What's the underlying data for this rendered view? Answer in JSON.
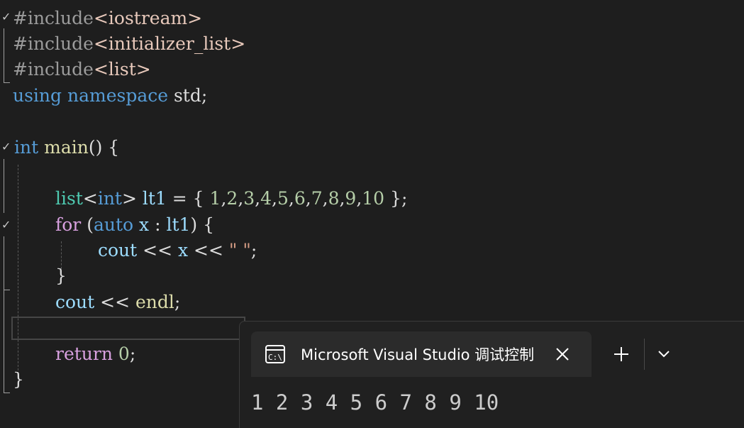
{
  "editor": {
    "lines": [
      {
        "tokens": [
          {
            "t": "#include",
            "c": "pp"
          },
          {
            "t": "<iostream>",
            "c": "inc"
          }
        ]
      },
      {
        "tokens": [
          {
            "t": "#include",
            "c": "pp"
          },
          {
            "t": "<initializer_list>",
            "c": "inc"
          }
        ]
      },
      {
        "tokens": [
          {
            "t": "#include",
            "c": "pp"
          },
          {
            "t": "<list>",
            "c": "inc"
          }
        ]
      },
      {
        "tokens": [
          {
            "t": "using",
            "c": "kw"
          },
          {
            "t": " ",
            "c": "pl"
          },
          {
            "t": "namespace",
            "c": "kw"
          },
          {
            "t": " std;",
            "c": "pl"
          }
        ]
      },
      {
        "tokens": []
      },
      {
        "tokens": [
          {
            "t": "int",
            "c": "kw"
          },
          {
            "t": " ",
            "c": "pl"
          },
          {
            "t": "main",
            "c": "fn"
          },
          {
            "t": "() {",
            "c": "pl"
          }
        ]
      },
      {
        "tokens": []
      },
      {
        "tokens": [
          {
            "t": "list",
            "c": "ty"
          },
          {
            "t": "<",
            "c": "pl"
          },
          {
            "t": "int",
            "c": "kw"
          },
          {
            "t": "> ",
            "c": "pl"
          },
          {
            "t": "lt1",
            "c": "var"
          },
          {
            "t": " = { ",
            "c": "pl"
          },
          {
            "t": "1",
            "c": "num"
          },
          {
            "t": ",",
            "c": "pl"
          },
          {
            "t": "2",
            "c": "num"
          },
          {
            "t": ",",
            "c": "pl"
          },
          {
            "t": "3",
            "c": "num"
          },
          {
            "t": ",",
            "c": "pl"
          },
          {
            "t": "4",
            "c": "num"
          },
          {
            "t": ",",
            "c": "pl"
          },
          {
            "t": "5",
            "c": "num"
          },
          {
            "t": ",",
            "c": "pl"
          },
          {
            "t": "6",
            "c": "num"
          },
          {
            "t": ",",
            "c": "pl"
          },
          {
            "t": "7",
            "c": "num"
          },
          {
            "t": ",",
            "c": "pl"
          },
          {
            "t": "8",
            "c": "num"
          },
          {
            "t": ",",
            "c": "pl"
          },
          {
            "t": "9",
            "c": "num"
          },
          {
            "t": ",",
            "c": "pl"
          },
          {
            "t": "10",
            "c": "num"
          },
          {
            "t": " };",
            "c": "pl"
          }
        ]
      },
      {
        "tokens": [
          {
            "t": "for",
            "c": "ctl"
          },
          {
            "t": " (",
            "c": "pl"
          },
          {
            "t": "auto",
            "c": "kw"
          },
          {
            "t": " ",
            "c": "pl"
          },
          {
            "t": "x",
            "c": "var"
          },
          {
            "t": " : ",
            "c": "pl"
          },
          {
            "t": "lt1",
            "c": "var"
          },
          {
            "t": ") {",
            "c": "pl"
          }
        ]
      },
      {
        "tokens": [
          {
            "t": "cout",
            "c": "var"
          },
          {
            "t": " << ",
            "c": "pl"
          },
          {
            "t": "x",
            "c": "var"
          },
          {
            "t": " << ",
            "c": "pl"
          },
          {
            "t": "\" \"",
            "c": "str"
          },
          {
            "t": ";",
            "c": "pl"
          }
        ]
      },
      {
        "tokens": [
          {
            "t": "}",
            "c": "pl"
          }
        ]
      },
      {
        "tokens": [
          {
            "t": "cout",
            "c": "var"
          },
          {
            "t": " << ",
            "c": "pl"
          },
          {
            "t": "endl",
            "c": "fn"
          },
          {
            "t": ";",
            "c": "pl"
          }
        ]
      },
      {
        "tokens": []
      },
      {
        "tokens": [
          {
            "t": "return",
            "c": "ctl"
          },
          {
            "t": " ",
            "c": "pl"
          },
          {
            "t": "0",
            "c": "num"
          },
          {
            "t": ";",
            "c": "pl"
          }
        ]
      },
      {
        "tokens": [
          {
            "t": "}",
            "c": "pl"
          }
        ]
      }
    ]
  },
  "terminal": {
    "tab_title": "Microsoft Visual Studio 调试控制台",
    "tab_icon": "console-icon",
    "close_icon": "close-icon",
    "new_tab_icon": "plus-icon",
    "dropdown_icon": "chevron-down-icon",
    "output": "1 2 3 4 5 6 7 8 9 10"
  }
}
